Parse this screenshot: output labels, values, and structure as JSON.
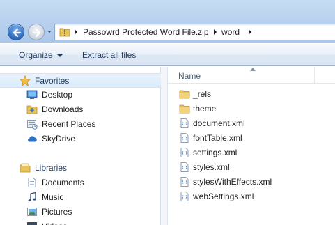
{
  "address_bar": {
    "crumbs": [
      "Passowrd Protected Word File.zip",
      "word"
    ]
  },
  "toolbar": {
    "organize_label": "Organize",
    "extract_label": "Extract all files"
  },
  "nav_pane": {
    "favorites": {
      "label": "Favorites",
      "items": [
        {
          "label": "Desktop",
          "icon": "desktop-icon"
        },
        {
          "label": "Downloads",
          "icon": "downloads-folder-icon"
        },
        {
          "label": "Recent Places",
          "icon": "recent-places-icon"
        },
        {
          "label": "SkyDrive",
          "icon": "skydrive-cloud-icon"
        }
      ]
    },
    "libraries": {
      "label": "Libraries",
      "items": [
        {
          "label": "Documents",
          "icon": "documents-icon"
        },
        {
          "label": "Music",
          "icon": "music-icon"
        },
        {
          "label": "Pictures",
          "icon": "pictures-icon"
        },
        {
          "label": "Videos",
          "icon": "videos-icon"
        }
      ]
    }
  },
  "file_list": {
    "column_name": "Name",
    "items": [
      {
        "name": "_rels",
        "type": "folder"
      },
      {
        "name": "theme",
        "type": "folder"
      },
      {
        "name": "document.xml",
        "type": "xml"
      },
      {
        "name": "fontTable.xml",
        "type": "xml"
      },
      {
        "name": "settings.xml",
        "type": "xml"
      },
      {
        "name": "styles.xml",
        "type": "xml"
      },
      {
        "name": "stylesWithEffects.xml",
        "type": "xml"
      },
      {
        "name": "webSettings.xml",
        "type": "xml"
      }
    ]
  },
  "colors": {
    "accent": "#3a78c9",
    "folder": "#e8c25a",
    "selected_bg": "#d9ebfb"
  }
}
